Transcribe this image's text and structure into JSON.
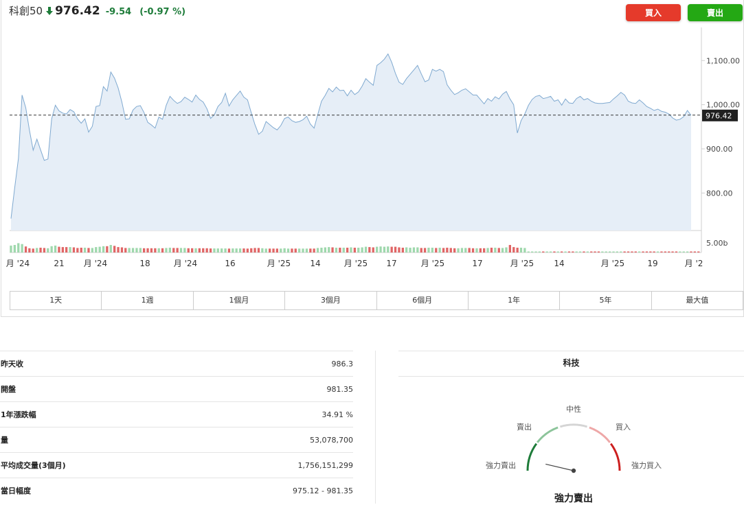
{
  "header": {
    "name": "科創50",
    "price": "976.42",
    "change": "-9.54",
    "change_pct": "(-0.97 %)",
    "direction_icon": "arrow-down-icon",
    "down_color": "#1e7c3a"
  },
  "buttons": {
    "buy": "買入",
    "sell": "賣出",
    "buy_color": "#e53a2b",
    "sell_color": "#24a814"
  },
  "chart_data": {
    "type": "area",
    "y_ticks": [
      "1,100.00",
      "1,000.00",
      "900.00",
      "800.00"
    ],
    "y_tick_values": [
      1100,
      1000,
      900,
      800
    ],
    "ylim": [
      715,
      1175
    ],
    "last_value": 976.42,
    "last_label": "976.42",
    "reference_line": 976.42,
    "volume_tick": "5.00b",
    "x_tick_labels": [
      "月 '24",
      "21",
      "月 '24",
      "18",
      "月 '24",
      "16",
      "月 '25",
      "14",
      "月 '25",
      "17",
      "月 '25",
      "17",
      "月 '25",
      "14",
      "月 '25",
      "19",
      "月 '2"
    ],
    "values": [
      742,
      812,
      878,
      1022,
      993,
      942,
      897,
      922,
      898,
      874,
      877,
      968,
      999,
      986,
      981,
      979,
      989,
      984,
      968,
      958,
      968,
      938,
      951,
      996,
      998,
      1041,
      1031,
      1074,
      1060,
      1038,
      1006,
      967,
      968,
      988,
      996,
      998,
      982,
      960,
      954,
      947,
      972,
      967,
      999,
      1019,
      1010,
      1003,
      1007,
      1017,
      1012,
      1006,
      1022,
      1012,
      1006,
      991,
      969,
      977,
      996,
      1005,
      1026,
      997,
      1011,
      1021,
      1031,
      1017,
      1011,
      982,
      955,
      933,
      940,
      962,
      955,
      948,
      943,
      953,
      969,
      972,
      964,
      960,
      962,
      966,
      974,
      956,
      947,
      978,
      1008,
      1021,
      1037,
      1029,
      1040,
      1032,
      1033,
      1020,
      1033,
      1023,
      1029,
      1042,
      1059,
      1051,
      1044,
      1089,
      1095,
      1103,
      1115,
      1096,
      1071,
      1051,
      1046,
      1059,
      1069,
      1079,
      1089,
      1070,
      1052,
      1056,
      1080,
      1076,
      1080,
      1075,
      1045,
      1033,
      1023,
      1027,
      1033,
      1036,
      1029,
      1022,
      1022,
      1012,
      1002,
      1014,
      1008,
      1018,
      1013,
      1024,
      1030,
      1013,
      1000,
      936,
      964,
      979,
      999,
      1012,
      1019,
      1021,
      1014,
      1016,
      1019,
      1008,
      1011,
      999,
      1013,
      1004,
      1003,
      1014,
      1019,
      1011,
      1014,
      1008,
      1004,
      1003,
      1003,
      1004,
      1005,
      1013,
      1020,
      1028,
      1022,
      1008,
      1004,
      1003,
      1011,
      1004,
      996,
      992,
      987,
      990,
      985,
      983,
      979,
      970,
      965,
      967,
      973,
      987,
      976
    ],
    "volume": [
      0.46,
      0.5,
      0.62,
      0.56,
      0.4,
      0.28,
      0.26,
      0.3,
      0.32,
      0.3,
      0.28,
      0.42,
      0.46,
      0.38,
      0.36,
      0.36,
      0.36,
      0.34,
      0.3,
      0.32,
      0.32,
      0.3,
      0.3,
      0.36,
      0.38,
      0.42,
      0.42,
      0.5,
      0.44,
      0.36,
      0.34,
      0.3,
      0.3,
      0.3,
      0.3,
      0.3,
      0.28,
      0.28,
      0.28,
      0.28,
      0.28,
      0.28,
      0.3,
      0.32,
      0.3,
      0.3,
      0.3,
      0.3,
      0.28,
      0.28,
      0.28,
      0.28,
      0.28,
      0.28,
      0.27,
      0.27,
      0.27,
      0.27,
      0.27,
      0.26,
      0.27,
      0.27,
      0.27,
      0.27,
      0.26,
      0.28,
      0.3,
      0.3,
      0.28,
      0.26,
      0.26,
      0.26,
      0.26,
      0.26,
      0.28,
      0.26,
      0.26,
      0.26,
      0.26,
      0.26,
      0.26,
      0.26,
      0.26,
      0.3,
      0.32,
      0.34,
      0.36,
      0.34,
      0.32,
      0.32,
      0.32,
      0.32,
      0.34,
      0.32,
      0.32,
      0.34,
      0.38,
      0.36,
      0.34,
      0.38,
      0.4,
      0.38,
      0.4,
      0.38,
      0.38,
      0.34,
      0.32,
      0.34,
      0.32,
      0.34,
      0.34,
      0.3,
      0.3,
      0.32,
      0.32,
      0.3,
      0.32,
      0.3,
      0.32,
      0.3,
      0.28,
      0.28,
      0.3,
      0.3,
      0.3,
      0.28,
      0.28,
      0.28,
      0.28,
      0.3,
      0.32,
      0.32,
      0.3,
      0.3,
      0.34,
      0.5,
      0.36,
      0.32,
      0.32,
      0.3,
      0.03,
      0.03,
      0.03,
      0.03,
      0.03,
      0.03,
      0.03,
      0.03,
      0.03,
      0.03,
      0.03,
      0.03,
      0.03,
      0.03,
      0.03,
      0.03,
      0.03,
      0.03,
      0.03,
      0.03,
      0.03,
      0.03,
      0.03,
      0.03,
      0.03,
      0.03,
      0.03,
      0.03,
      0.03,
      0.03,
      0.03,
      0.03,
      0.03,
      0.03,
      0.03,
      0.03,
      0.03,
      0.03,
      0.03,
      0.03,
      0.03,
      0.03,
      0.03,
      0.03,
      0.03,
      0.03,
      0.03
    ],
    "colors": {
      "line": "#7fa9d0",
      "fill": "#e6eef7",
      "vol_up": "#9fd8ad",
      "vol_down": "#e06666"
    }
  },
  "ranges": [
    "1天",
    "1週",
    "1個月",
    "3個月",
    "6個月",
    "1年",
    "5年",
    "最大值"
  ],
  "stats": [
    {
      "label": "昨天收",
      "value": "986.3"
    },
    {
      "label": "開盤",
      "value": "981.35"
    },
    {
      "label": "1年漲跌幅",
      "value": "34.91 %"
    },
    {
      "label": "量",
      "value": "53,078,700"
    },
    {
      "label": "平均成交量(3個月)",
      "value": "1,756,151,299"
    },
    {
      "label": "當日幅度",
      "value": "975.12 - 981.35"
    }
  ],
  "technical": {
    "title": "科技",
    "labels": {
      "neutral": "中性",
      "sell": "賣出",
      "buy": "買入",
      "strong_sell": "強力賣出",
      "strong_buy": "強力買入"
    },
    "result": "強力賣出",
    "needle_level": 0.07,
    "colors": {
      "strong_sell": "#1e7c3a",
      "sell": "#8cc49a",
      "neutral": "#d5d5d5",
      "buy": "#eea7a7",
      "strong_buy": "#cc1f1f"
    }
  }
}
